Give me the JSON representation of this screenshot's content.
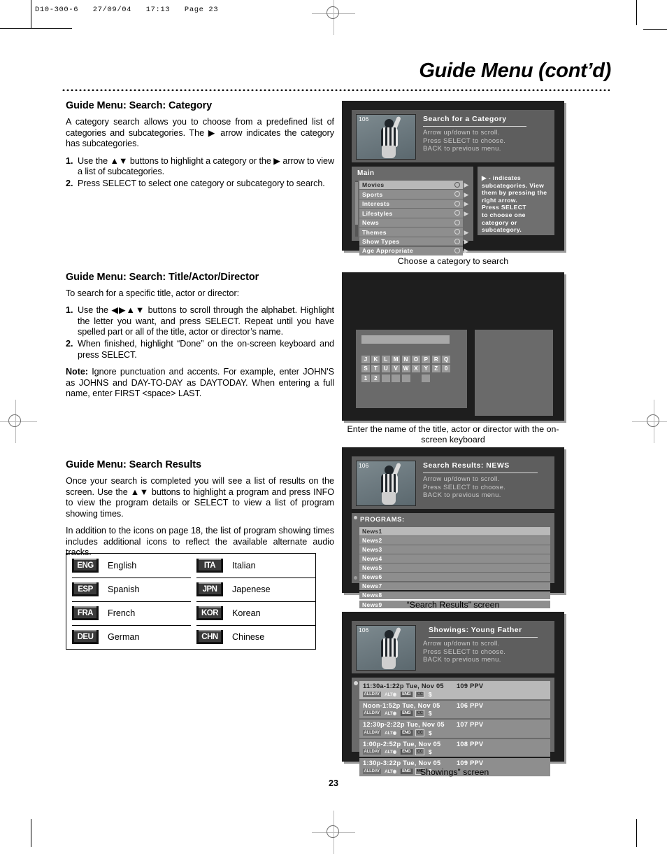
{
  "print_marks": {
    "file_header": "D10-300-6   27/09/04   17:13   Page 23"
  },
  "page": {
    "title": "Guide Menu (cont’d)",
    "number": "23"
  },
  "sections": [
    {
      "heading": "Guide Menu: Search: Category",
      "paragraphs": [
        "A category search allows you to choose from a predefined list of categories and subcategories. The ▶ arrow indicates the category has subcategories."
      ],
      "steps": [
        "Use the ▲▼ buttons to highlight a category or the ▶ arrow to view a list of subcategories.",
        "Press SELECT to select one category or subcategory to search."
      ]
    },
    {
      "heading": "Guide Menu: Search: Title/Actor/Director",
      "paragraphs": [
        "To search for a specific title, actor or director:"
      ],
      "steps": [
        "Use the ◀▶▲▼ buttons to scroll through the alphabet. Highlight the letter you want, and press SELECT. Repeat until you have spelled part or all of the title, actor or director’s name.",
        "When finished, highlight “Done” on the on-screen keyboard and press SELECT."
      ],
      "note_label": "Note:",
      "note_text": " Ignore punctuation and accents. For example, enter JOHN'S as JOHNS and DAY-TO-DAY as DAYTODAY. When entering a full name, enter FIRST <space> LAST."
    },
    {
      "heading": "Guide Menu: Search Results",
      "paragraphs": [
        "Once your search is completed you will see a list of results on the screen. Use the ▲▼ buttons to highlight a program and press INFO to view the program details or SELECT to view a list of program showing times.",
        "In addition to the icons on page 18, the list of program showing times includes additional icons to reflect the available alternate audio tracks."
      ]
    }
  ],
  "language_table": {
    "rows": [
      {
        "left": {
          "code": "ENG",
          "name": "English"
        },
        "right": {
          "code": "ITA",
          "name": "Italian"
        }
      },
      {
        "left": {
          "code": "ESP",
          "name": "Spanish"
        },
        "right": {
          "code": "JPN",
          "name": "Japenese"
        }
      },
      {
        "left": {
          "code": "FRA",
          "name": "French"
        },
        "right": {
          "code": "KOR",
          "name": "Korean"
        }
      },
      {
        "left": {
          "code": "DEU",
          "name": "German"
        },
        "right": {
          "code": "CHN",
          "name": "Chinese"
        }
      }
    ]
  },
  "screens": {
    "category": {
      "caption": "Choose a category to search",
      "channel": "106",
      "title": "Search for a Category",
      "hint_lines": "Arrow up/down to scroll.\nPress SELECT to choose.\nBACK to previous menu.",
      "panel_title": "Main",
      "items": [
        {
          "label": "Movies",
          "selected": true,
          "arrow": true
        },
        {
          "label": "Sports",
          "selected": false,
          "arrow": true
        },
        {
          "label": "Interests",
          "selected": false,
          "arrow": true
        },
        {
          "label": "Lifestyles",
          "selected": false,
          "arrow": true
        },
        {
          "label": "News",
          "selected": false,
          "arrow": false
        },
        {
          "label": "Themes",
          "selected": false,
          "arrow": true
        },
        {
          "label": "Show Types",
          "selected": false,
          "arrow": true
        },
        {
          "label": "Age Appropriate",
          "selected": false,
          "arrow": true
        }
      ],
      "side_hint": "▶ -  indicates subcategories. View them by pressing the right arrow.\nPress SELECT\nto choose one category or subcategory."
    },
    "keyboard": {
      "caption": "Enter the name of the title, actor or director with the on-screen keyboard",
      "entry_value": "",
      "rows": [
        [
          "J",
          "K",
          "L",
          "M",
          "N",
          "O",
          "P",
          "R",
          "Q"
        ],
        [
          "S",
          "T",
          "U",
          "V",
          "W",
          "X",
          "Y",
          "Z",
          "0"
        ],
        [
          "1",
          "2",
          "",
          "",
          "",
          " ",
          ""
        ]
      ]
    },
    "results": {
      "caption": "“Search Results” screen",
      "channel": "106",
      "title": "Search Results: NEWS",
      "hint_lines": "Arrow up/down to scroll.\nPress SELECT to choose.\nBACK to previous menu.",
      "panel_title": "PROGRAMS:",
      "items": [
        {
          "label": "News1",
          "selected": true
        },
        {
          "label": "News2",
          "selected": false
        },
        {
          "label": "News3",
          "selected": false
        },
        {
          "label": "News4",
          "selected": false
        },
        {
          "label": "News5",
          "selected": false
        },
        {
          "label": "News6",
          "selected": false
        },
        {
          "label": "News7",
          "selected": false
        },
        {
          "label": "News8",
          "selected": false
        },
        {
          "label": "News9",
          "selected": false
        }
      ]
    },
    "showings": {
      "caption": "“Showings” screen",
      "channel": "106",
      "title": "Showings: Young Father",
      "hint_lines": "Arrow up/down to scroll.\nPress SELECT to choose.\nBACK to previous menu.",
      "items": [
        {
          "time": "11:30a-1:22p Tue, Nov 05",
          "channel": "109 PPV",
          "selected": true,
          "icons": [
            "ALLDAY",
            "ALT",
            "ENG",
            "CC",
            "$"
          ]
        },
        {
          "time": "Noon-1:52p Tue, Nov 05",
          "channel": "106 PPV",
          "selected": false,
          "icons": [
            "ALLDAY",
            "ALT",
            "ENG",
            "CC",
            "$"
          ]
        },
        {
          "time": "12:30p-2:22p Tue, Nov 05",
          "channel": "107 PPV",
          "selected": false,
          "icons": [
            "ALLDAY",
            "ALT",
            "ENG",
            "CC",
            "$"
          ]
        },
        {
          "time": "1:00p-2:52p Tue, Nov 05",
          "channel": "108 PPV",
          "selected": false,
          "icons": [
            "ALLDAY",
            "ALT",
            "ENG",
            "CC",
            "$"
          ]
        },
        {
          "time": "1:30p-3:22p Tue, Nov 05",
          "channel": "109 PPV",
          "selected": false,
          "icons": [
            "ALLDAY",
            "ALT",
            "ENG",
            "CC",
            "$"
          ]
        }
      ]
    }
  }
}
